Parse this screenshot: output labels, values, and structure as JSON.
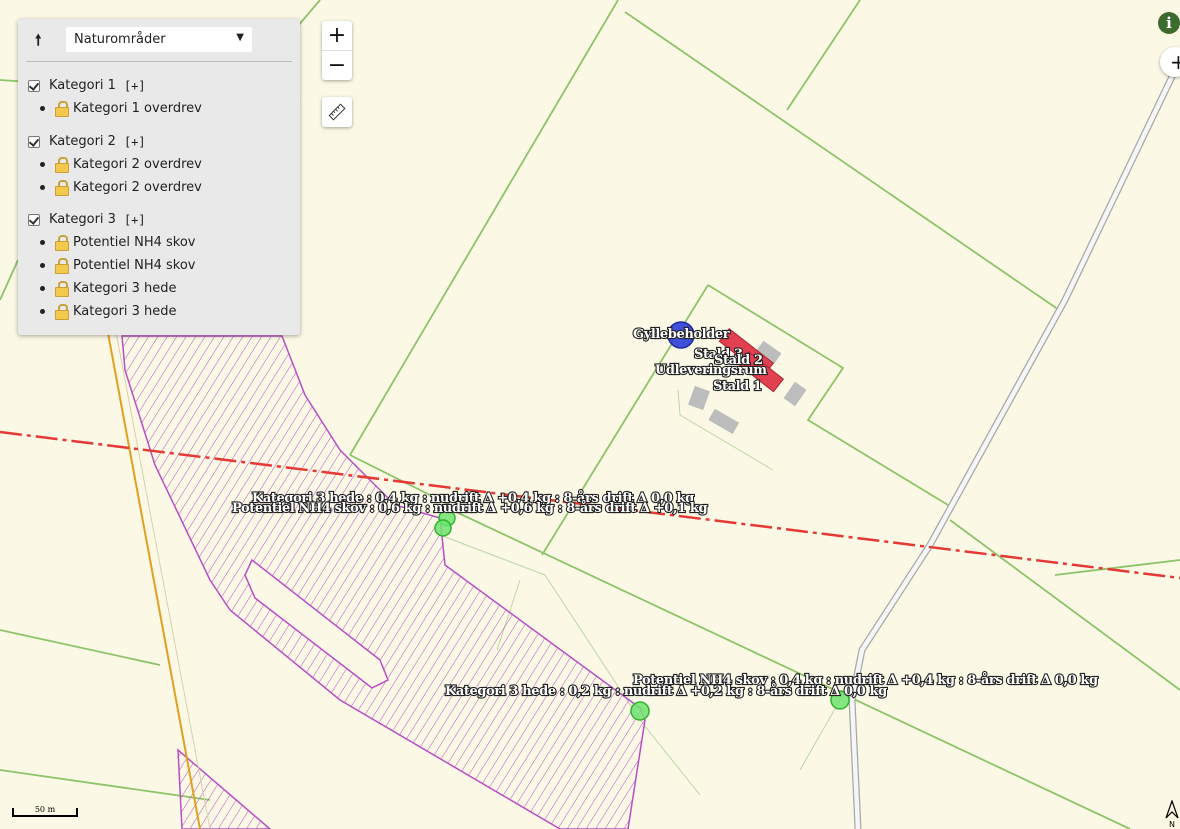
{
  "legend": {
    "dropdown_selected": "Naturområder",
    "expand_label": "[+]",
    "groups": [
      {
        "title": "Kategori 1",
        "checked": true,
        "items": [
          "Kategori 1 overdrev"
        ]
      },
      {
        "title": "Kategori 2",
        "checked": true,
        "items": [
          "Kategori 2 overdrev",
          "Kategori 2 overdrev"
        ]
      },
      {
        "title": "Kategori 3",
        "checked": true,
        "items": [
          "Potentiel NH4 skov",
          "Potentiel NH4 skov",
          "Kategori 3 hede",
          "Kategori 3 hede"
        ]
      }
    ]
  },
  "controls": {
    "zoom_in": "+",
    "zoom_out": "−",
    "info": "i",
    "right_plus": "+"
  },
  "map_labels": {
    "gyllebeholder": "Gyllebeholder",
    "stald3": "Stald 3",
    "stald2": "Stald 2",
    "udlevering": "Udleveringsrum",
    "stald1": "Stald 1",
    "deposition_a": "Kategori 3 hede : 0,4 kg : nudrift Δ +0,4 kg : 8-års drift Δ 0,0 kg",
    "deposition_b": "Potentiel NH4 skov : 0,6 kg : nudrift Δ +0,6 kg : 8-års drift Δ +0,1 kg",
    "deposition_c": "Potentiel NH4 skov : 0,4 kg : nudrift Δ +0,4 kg : 8-års drift Δ 0,0 kg",
    "deposition_d": "Kategori 3 hede : 0,2 kg : nudrift Δ +0,2 kg : 8-års drift Δ 0,0 kg"
  },
  "scale": {
    "label": "50 m"
  },
  "north": {
    "label": "N"
  },
  "colors": {
    "background": "#fbf8e5",
    "field_lines": "#8dc46a",
    "boundary_line": "#e53935",
    "hatch": "#b94fc4",
    "building": "#bdbdbd",
    "stable": "#e04050",
    "tank": "#3f51d8",
    "receptor": "#52e052"
  }
}
